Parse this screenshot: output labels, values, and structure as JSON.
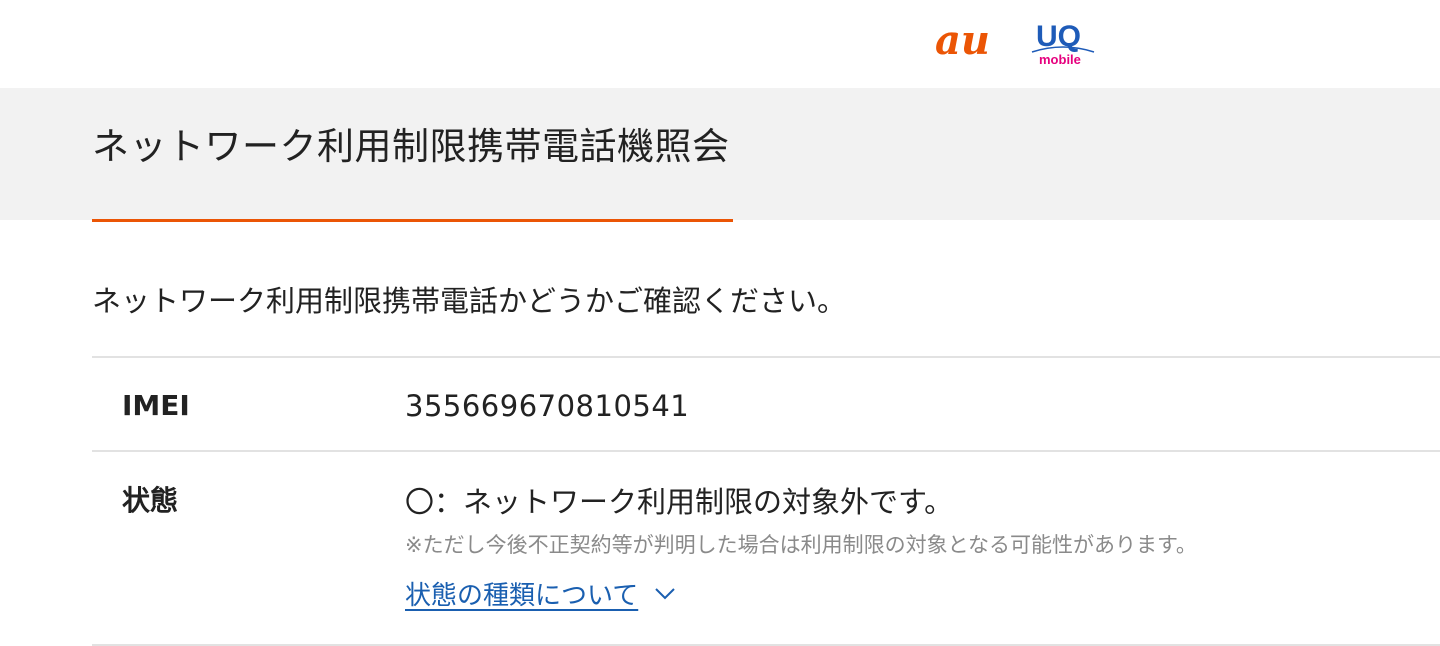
{
  "header": {
    "logos": [
      {
        "name": "au",
        "text": "au",
        "color": "#eb5505"
      },
      {
        "name": "uq-mobile",
        "text": "UQ",
        "subtext": "mobile",
        "color": "#1e5bb8",
        "subtext_color": "#e6007e"
      }
    ]
  },
  "page": {
    "title": "ネットワーク利用制限携帯電話機照会",
    "intro": "ネットワーク利用制限携帯電話かどうかご確認ください。"
  },
  "rows": [
    {
      "label": "IMEI",
      "value": "355669670810541"
    },
    {
      "label": "状態",
      "value": "〇：ネットワーク利用制限の対象外です。",
      "note": "※ただし今後不正契約等が判明した場合は利用制限の対象となる可能性があります。",
      "link_label": "状態の種類について",
      "link_icon": "chevron-down-icon"
    }
  ],
  "colors": {
    "accent": "#eb5505",
    "link": "#1a5fb0",
    "band": "#f2f2f2",
    "divider": "#e2e2e2"
  }
}
